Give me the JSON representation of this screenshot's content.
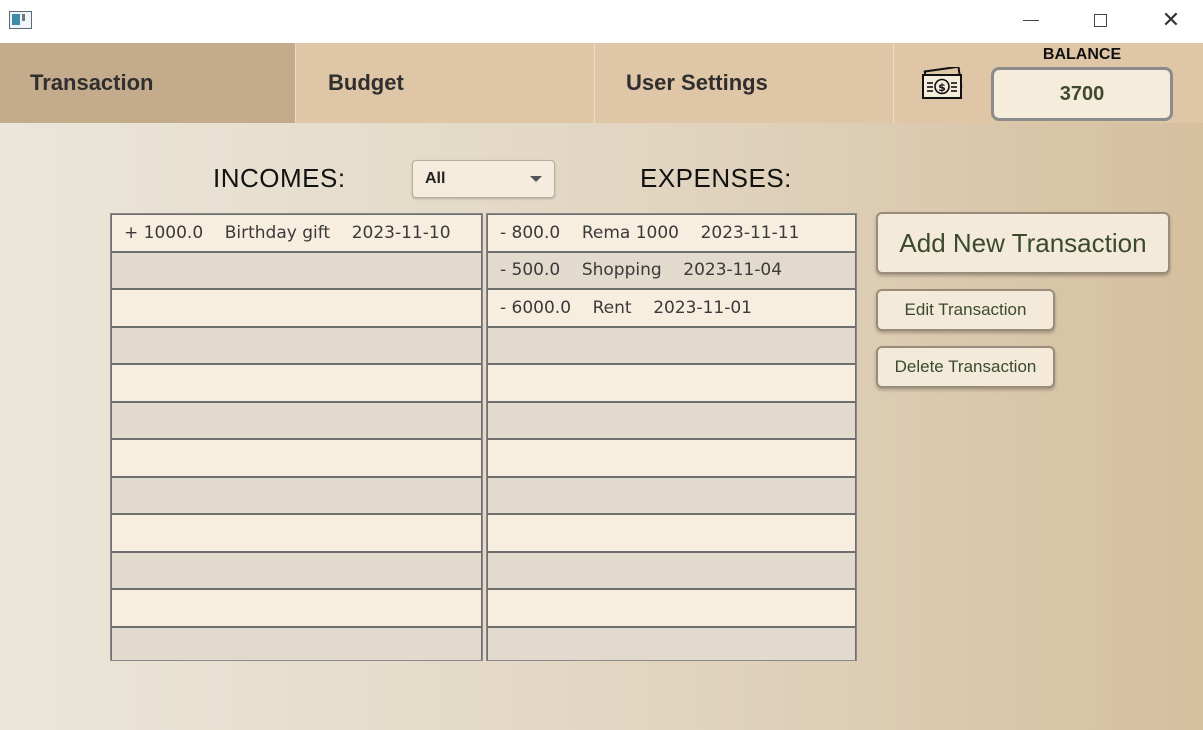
{
  "window": {
    "minimize_icon": "minimize-icon",
    "maximize_icon": "maximize-icon",
    "close_icon": "close-icon"
  },
  "nav": {
    "tabs": [
      {
        "label": "Transaction",
        "active": true
      },
      {
        "label": "Budget"
      },
      {
        "label": "User Settings"
      }
    ],
    "balance_label": "BALANCE",
    "balance_value": "3700",
    "money_icon": "money-bill-icon"
  },
  "main": {
    "incomes_heading": "INCOMES:",
    "expenses_heading": "EXPENSES:",
    "filter_value": "All",
    "incomes": [
      "+ 1000.0    Birthday gift    2023-11-10"
    ],
    "expenses": [
      "- 800.0    Rema 1000    2023-11-11",
      "- 500.0    Shopping    2023-11-04",
      "- 6000.0    Rent    2023-11-01"
    ],
    "buttons": {
      "add": "Add New Transaction",
      "edit": "Edit Transaction",
      "delete": "Delete Transaction"
    }
  },
  "colors": {
    "nav_bg": "#dfc6a6",
    "nav_active": "#c4ab8b",
    "row_light": "#f8eee0",
    "row_dark": "#e2dacd",
    "button_text": "#3b4a2e"
  }
}
